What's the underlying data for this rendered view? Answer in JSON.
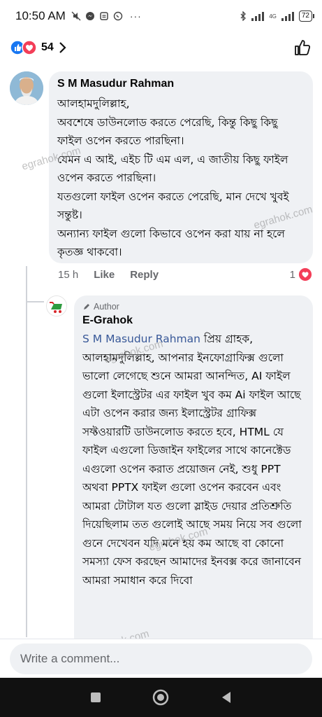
{
  "status_bar": {
    "time": "10:50 AM",
    "battery": "72",
    "network": "4G"
  },
  "reactions": {
    "count": "54"
  },
  "comment": {
    "author": "S M Masudur Rahman",
    "text": "আলহামদুলিল্লাহ,\n অবশেষে ডাউনলোড করতে পেরেছি, কিন্তু কিছু কিছু ফাইল ওপেন করতে পারছিনা।\nযেমন এ আই, এইচ টি এম এল, এ জাতীয় কিছু ফাইল ওপেন করতে পারছিনা।\nযতগুলো ফাইল ওপেন করতে পেরেছি, মান দেখে খুবই সন্তুষ্ট।\nঅন্যান্য ফাইল গুলো কিভাবে ওপেন করা যায় না হলে কৃতজ্ঞ থাকবো।",
    "time": "15 h",
    "like_label": "Like",
    "reply_label": "Reply",
    "reaction_count": "1"
  },
  "reply": {
    "badge": "Author",
    "author": "E-Grahok",
    "mention": "S M Masudur Rahman",
    "text": " প্রিয় গ্রাহক, আলহামদুলিল্লাহ, আপনার ইনফোগ্রাফিক্স গুলো ভালো লেগেছে শুনে আমরা আনন্দিত, AI ফাইল গুলো ইলাস্ট্রেটর এর ফাইল খুব কম Ai ফাইল আছে এটা ওপেন করার জন্য ইলাস্ট্রেটর গ্রাফিক্স সফ্টওয়ারটি ডাউনলোড করতে হবে, HTML যে ফাইল এগুলো ডিজাইন ফাইলের সাথে কানেক্টেড এগুলো ওপেন করাত প্রয়োজন নেই, শুধু PPT অথবা PPTX ফাইল গুলো ওপেন করবেন এবং আমরা টোটাল যত গুলো স্লাইড দেয়ার প্রতিশ্রুতি দিয়েছিলাম তত গুলোই আছে সময় নিয়ে সব গুলো গুনে দেখেবন যদি মনে হয় কম আছে বা কোনো সমস্যা ফেস করছেন আমাদের ইনবক্স করে জানাবেন আমরা সমাধান করে দিবো"
  },
  "watermark": "egrahok.com",
  "input": {
    "placeholder": "Write a comment..."
  },
  "colors": {
    "like_blue": "#1877f2",
    "love_red": "#f33e58",
    "bubble": "#eff1f4",
    "mention": "#385898"
  }
}
